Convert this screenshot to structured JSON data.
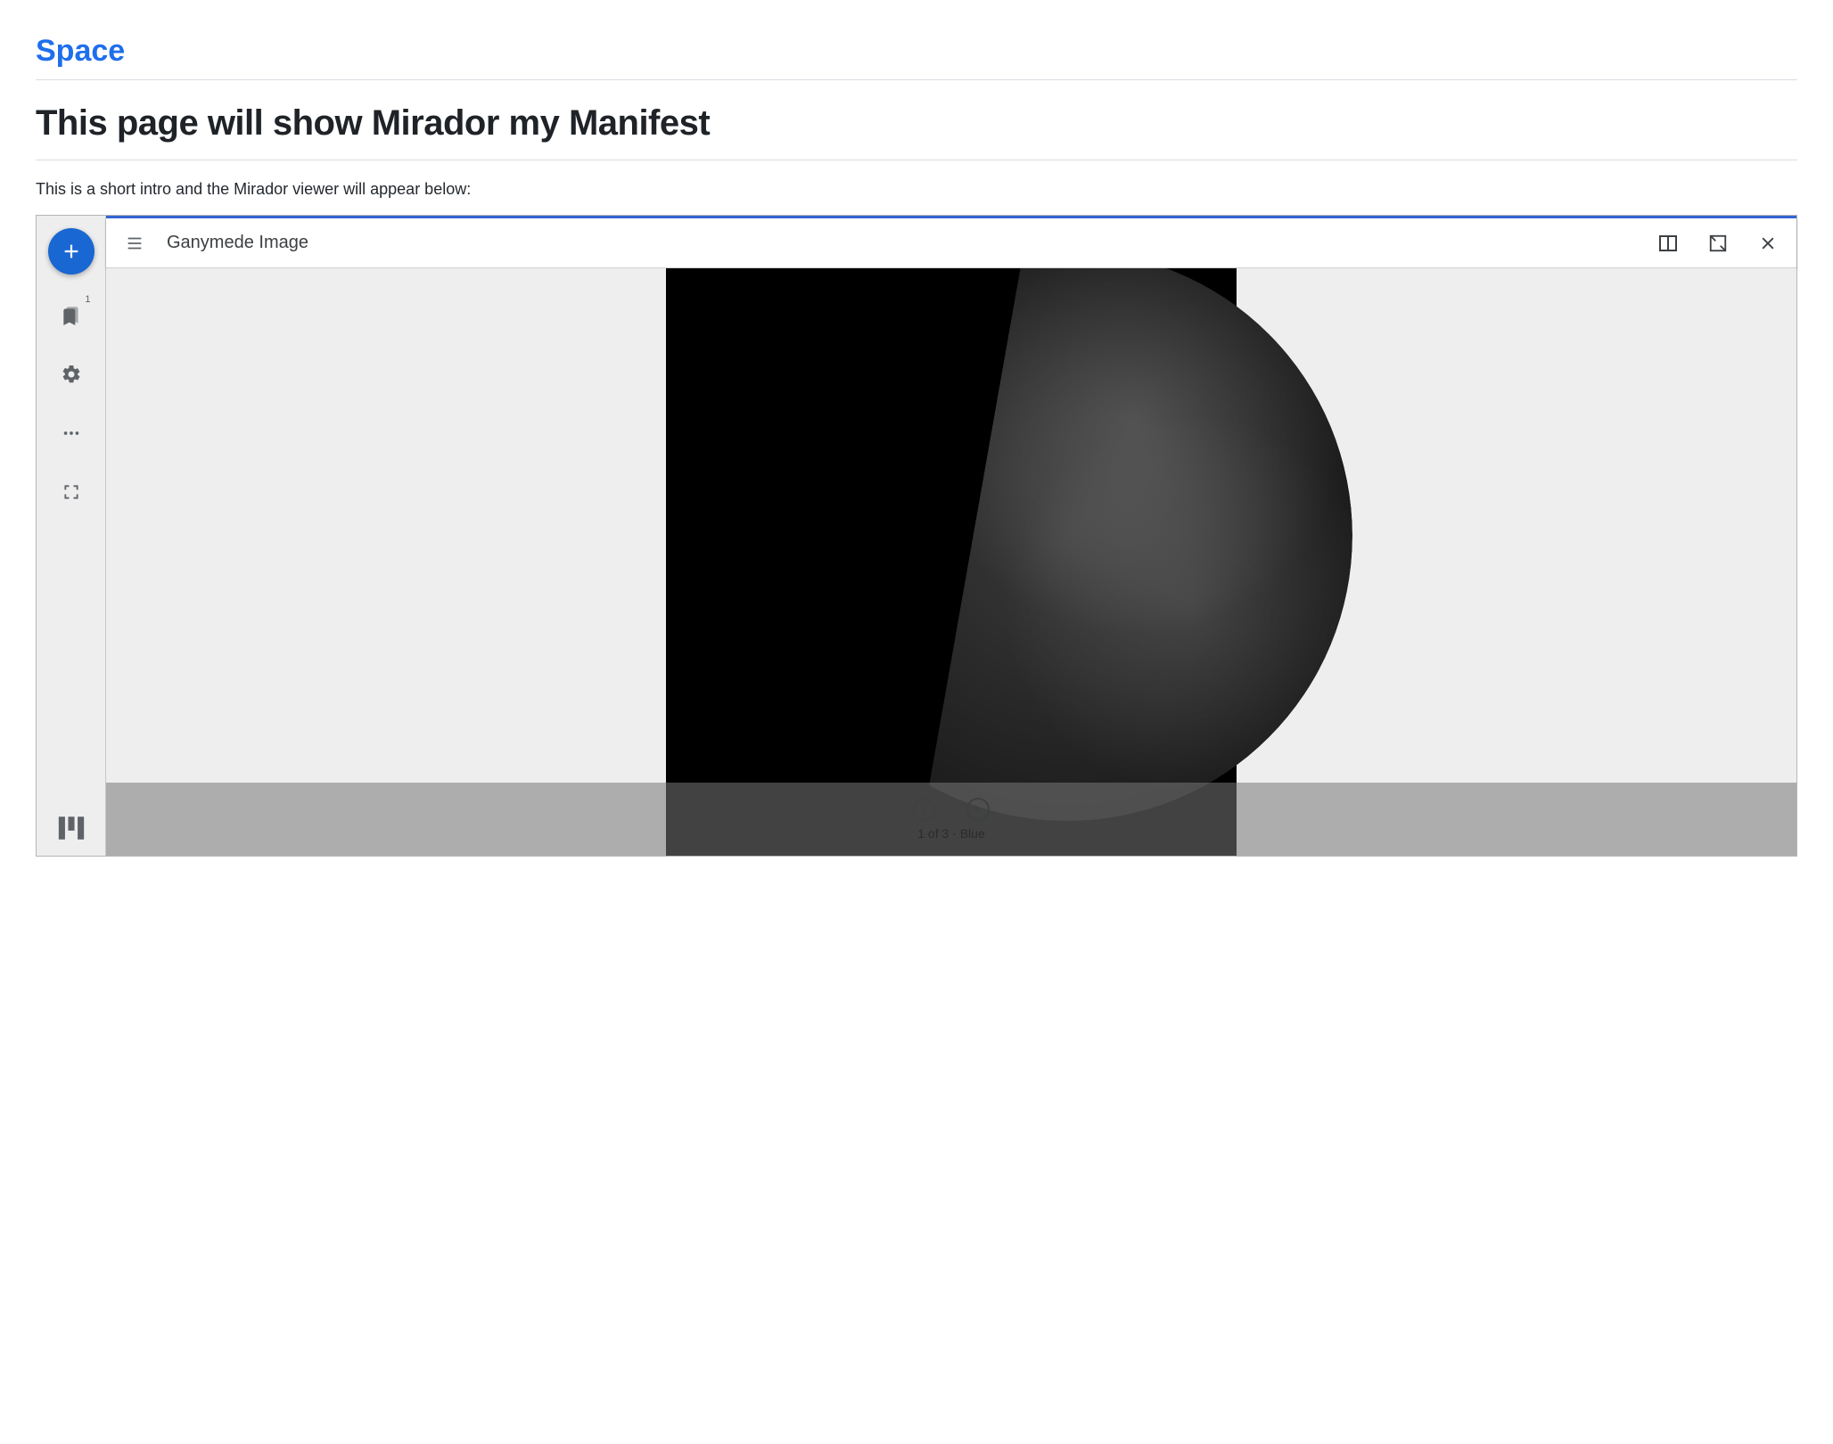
{
  "site_title": "Space",
  "page_heading": "This page will show Mirador my Manifest",
  "intro": "This is a short intro and the Mirador viewer will appear below:",
  "rail": {
    "resource_count": "1"
  },
  "window": {
    "title": "Ganymede Image",
    "caption": "1 of 3 · Blue"
  }
}
